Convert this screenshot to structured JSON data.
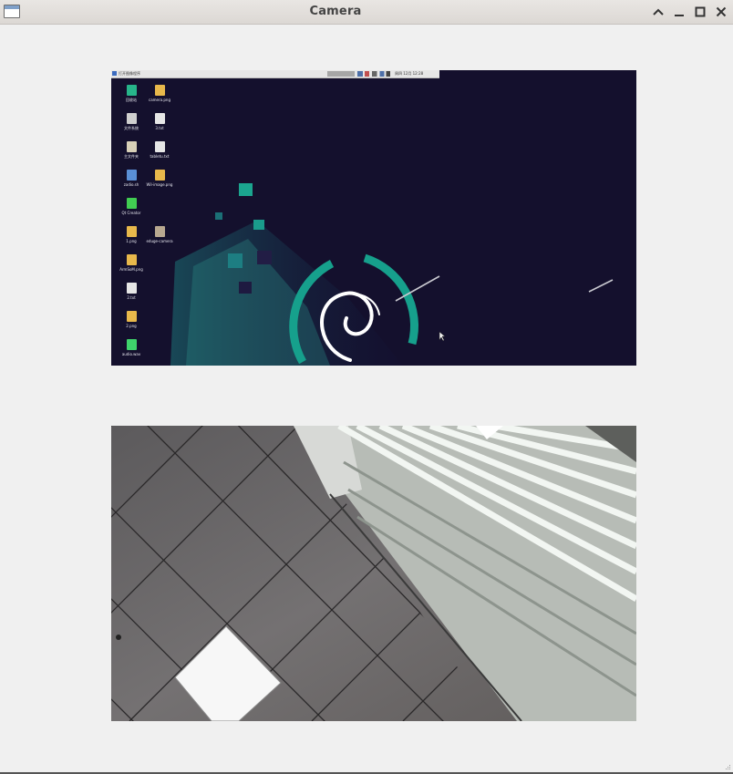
{
  "window": {
    "title": "Camera",
    "app_icon": "window-icon",
    "controls": [
      "chevron-up-icon",
      "minimize-icon",
      "maximize-icon",
      "close-icon"
    ]
  },
  "desktop_preview": {
    "taskbar_label": "打开图像程序",
    "clock": "周四 12月 12:28",
    "desktop_icons": [
      {
        "label": "回收站",
        "icon": "trash-icon",
        "color": "#27b58a"
      },
      {
        "label": "camera.png",
        "icon": "image-file-icon",
        "color": "#e8b84b"
      },
      {
        "label": "文件系统",
        "icon": "drive-icon",
        "color": "#cfcfcf"
      },
      {
        "label": "3.txt",
        "icon": "text-file-icon",
        "color": "#e6e6e6"
      },
      {
        "label": "主文件夹",
        "icon": "home-folder-icon",
        "color": "#d8d0b8"
      },
      {
        "label": "tabletu.txt",
        "icon": "text-file-icon",
        "color": "#e6e6e6"
      },
      {
        "label": "zadio.sh",
        "icon": "script-file-icon",
        "color": "#5a8fd6"
      },
      {
        "label": "Wil-image.png",
        "icon": "image-file-icon",
        "color": "#e8b84b"
      },
      {
        "label": "Qt Creator",
        "icon": "qt-creator-icon",
        "color": "#41cd52"
      },
      {
        "label": "1.png",
        "icon": "image-file-icon",
        "color": "#e8b84b"
      },
      {
        "label": "eduge-camera",
        "icon": "folder-icon",
        "color": "#b8a890"
      },
      {
        "label": "ArmSoM.png",
        "icon": "image-file-icon",
        "color": "#e8b84b"
      },
      {
        "label": "2.txt",
        "icon": "text-file-icon",
        "color": "#e6e6e6"
      },
      {
        "label": "2.png",
        "icon": "image-file-icon",
        "color": "#e8b84b"
      },
      {
        "label": "audio.wav",
        "icon": "music-file-icon",
        "color": "#3fd46c"
      }
    ]
  },
  "colors": {
    "desktop_bg": "#14102d",
    "teal": "#1aa38f",
    "ceiling": "#6a6869"
  }
}
